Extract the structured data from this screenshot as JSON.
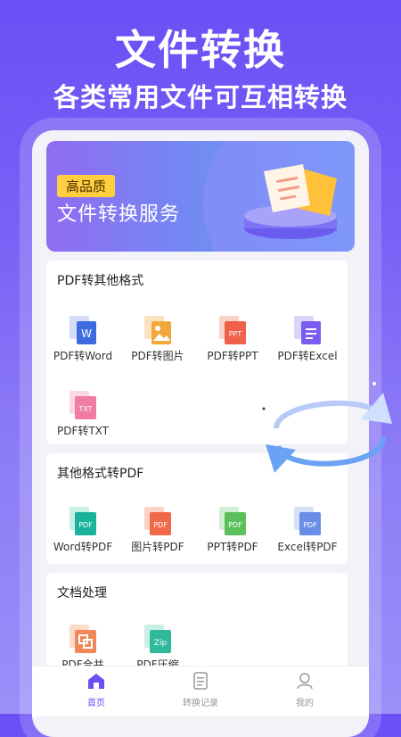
{
  "promo": {
    "title": "文件转换",
    "subtitle": "各类常用文件可互相转换"
  },
  "banner": {
    "badge": "高品质",
    "title": "文件转换服务"
  },
  "sections": [
    {
      "title": "PDF转其他格式",
      "tools": [
        {
          "label": "PDF转Word",
          "badge": "W",
          "color": "#3d6be0"
        },
        {
          "label": "PDF转图片",
          "badge": "img",
          "color": "#f3a93a"
        },
        {
          "label": "PDF转PPT",
          "badge": "PPT",
          "color": "#f0604a"
        },
        {
          "label": "PDF转Excel",
          "badge": "doc",
          "color": "#7a5cf0"
        },
        {
          "label": "PDF转TXT",
          "badge": "TXT",
          "color": "#f07ca2"
        }
      ]
    },
    {
      "title": "其他格式转PDF",
      "tools": [
        {
          "label": "Word转PDF",
          "badge": "PDF",
          "color": "#1ab39a"
        },
        {
          "label": "图片转PDF",
          "badge": "PDF",
          "color": "#f06a4a"
        },
        {
          "label": "PPT转PDF",
          "badge": "PDF",
          "color": "#5cc05a"
        },
        {
          "label": "Excel转PDF",
          "badge": "PDF",
          "color": "#6a8ee8"
        }
      ]
    },
    {
      "title": "文档处理",
      "tools": [
        {
          "label": "PDF合并",
          "badge": "merge",
          "color": "#f0885a"
        },
        {
          "label": "PDF压缩",
          "badge": "Zip",
          "color": "#2fb99a"
        }
      ]
    }
  ],
  "tabs": [
    {
      "label": "首页",
      "active": true,
      "icon": "home-icon"
    },
    {
      "label": "转换记录",
      "active": false,
      "icon": "list-icon"
    },
    {
      "label": "我的",
      "active": false,
      "icon": "user-icon"
    }
  ],
  "colors": {
    "accent": "#6a4ff5",
    "tab_active": "#6a4ff5",
    "tab_inactive": "#999999"
  }
}
